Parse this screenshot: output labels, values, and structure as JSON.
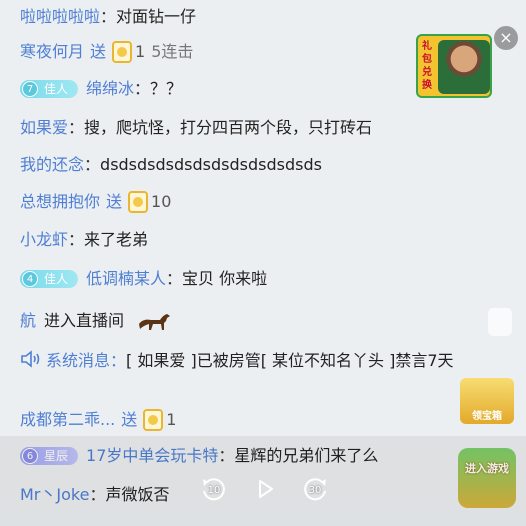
{
  "chat": {
    "messages": [
      {
        "user": "啦啦啦啦啦",
        "sep": "：",
        "text": "对面钻一仔"
      },
      {
        "user": "寒夜何月",
        "send": "送",
        "gift_count": "1",
        "combo": "5连击"
      },
      {
        "badge_level": "7",
        "badge_label": "佳人",
        "user": "绵绵冰",
        "sep": "：",
        "text": "？？"
      },
      {
        "user": "如果爱",
        "sep": "：",
        "text": "搜，爬坑怪，打分四百两个段，只打砖石"
      },
      {
        "user": "我的还念",
        "sep": "：",
        "text": "dsdsdsdsdsdsdsdsdsdsdsds"
      },
      {
        "user": "总想拥抱你",
        "send": "送",
        "gift_count": "10"
      },
      {
        "user": "小龙虾",
        "sep": "：",
        "text": "来了老弟"
      },
      {
        "badge_level": "4",
        "badge_label": "佳人",
        "user": "低调楠某人",
        "sep": "：",
        "text": "宝贝 你来啦"
      },
      {
        "user": "航",
        "text": "进入直播间"
      },
      {
        "user": "成都第二乖...",
        "send": "送",
        "gift_count": "1"
      },
      {
        "badge_level": "6",
        "badge_label": "星辰",
        "user": "17岁中单会玩卡特",
        "sep": "：",
        "text": "星辉的兄弟们来了么"
      },
      {
        "user": "Mr丶Joke",
        "sep": "：",
        "text": "声微饭否"
      }
    ],
    "system": {
      "label": "系统消息",
      "sep": "：",
      "text": "[ 如果爱 ]已被房管[ 某位不知名丫头 ]禁言7天"
    }
  },
  "overlays": {
    "promo_tag": "礼包兑换",
    "close": "×",
    "treasure_label": "领宝箱",
    "game_label": "进入游戏"
  },
  "player": {
    "rewind_seconds": "10",
    "forward_seconds": "30"
  }
}
